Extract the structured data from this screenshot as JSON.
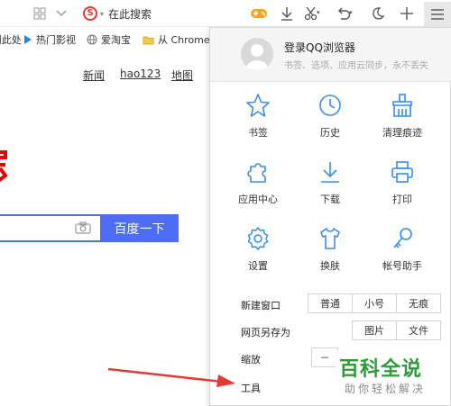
{
  "toolbar": {
    "search_placeholder": "在此搜索",
    "search_engine_letter": "S",
    "icons": [
      "grid-icon",
      "chevron-down-icon",
      "search-engine-icon",
      "game-icon",
      "download-icon",
      "scissors-icon",
      "undo-icon",
      "moon-icon",
      "plus-icon",
      "menu-icon"
    ]
  },
  "bookmarks": {
    "items": [
      {
        "label": "Ctrl+D 收藏到此处"
      },
      {
        "label": "热门影视"
      },
      {
        "label": "爱淘宝"
      },
      {
        "label": "从 Chrome"
      }
    ]
  },
  "page": {
    "links": [
      "新闻",
      "hao123",
      "地图"
    ],
    "search_button": "百度一下"
  },
  "menu": {
    "login_title": "登录QQ浏览器",
    "login_subtitle": "书签、选项、应用云同步，永不丢失",
    "grid": [
      {
        "label": "书签",
        "icon": "star-icon"
      },
      {
        "label": "历史",
        "icon": "clock-icon"
      },
      {
        "label": "清理痕迹",
        "icon": "broom-icon"
      },
      {
        "label": "应用中心",
        "icon": "puzzle-icon"
      },
      {
        "label": "下载",
        "icon": "download-icon"
      },
      {
        "label": "打印",
        "icon": "printer-icon"
      },
      {
        "label": "设置",
        "icon": "gear-icon"
      },
      {
        "label": "换肤",
        "icon": "tshirt-icon"
      },
      {
        "label": "帐号助手",
        "icon": "key-icon"
      }
    ],
    "new_window": {
      "label": "新建窗口",
      "options": [
        "普通",
        "小号",
        "无痕"
      ]
    },
    "save_as": {
      "label": "网页另存为",
      "options": [
        "图片",
        "文件"
      ]
    },
    "zoom": {
      "label": "缩放",
      "minus": "－"
    },
    "tools": {
      "label": "工具"
    }
  },
  "watermark": {
    "main": "百科全说",
    "sub": "助你轻松解决"
  },
  "colors": {
    "accent_blue": "#3a8ee6",
    "baidu_blue": "#4e6ef2",
    "watermark_green": "#2e9b3a",
    "arrow_red": "#e53935"
  }
}
